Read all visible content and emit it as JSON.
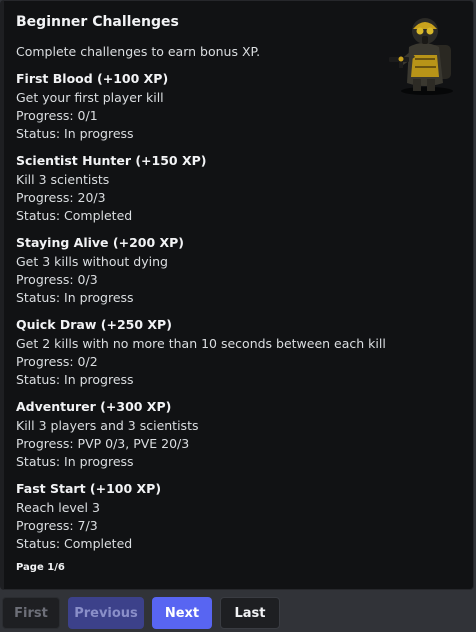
{
  "embed": {
    "title": "Beginner Challenges",
    "description": "Complete challenges to earn bonus XP.",
    "thumbnail_icon": "hazmat-soldier-icon",
    "footer": "Page 1/6",
    "fields": [
      {
        "name": "First Blood (+100 XP)",
        "task": "Get your first player kill",
        "progress": "Progress: 0/1",
        "status": "Status: In progress"
      },
      {
        "name": "Scientist Hunter (+150 XP)",
        "task": "Kill 3 scientists",
        "progress": "Progress: 20/3",
        "status": "Status: Completed"
      },
      {
        "name": "Staying Alive (+200 XP)",
        "task": "Get 3 kills without dying",
        "progress": "Progress: 0/3",
        "status": "Status: In progress"
      },
      {
        "name": "Quick Draw (+250 XP)",
        "task": "Get 2 kills with no more than 10 seconds between each kill",
        "progress": "Progress: 0/2",
        "status": "Status: In progress"
      },
      {
        "name": "Adventurer (+300 XP)",
        "task": "Kill 3 players and 3 scientists",
        "progress": "Progress: PVP 0/3, PVE 20/3",
        "status": "Status: In progress"
      },
      {
        "name": "Fast Start (+100 XP)",
        "task": "Reach level 3",
        "progress": "Progress: 7/3",
        "status": "Status: Completed"
      }
    ]
  },
  "buttons": {
    "first": "First",
    "previous": "Previous",
    "next": "Next",
    "last": "Last"
  },
  "colors": {
    "blurple": "#5865f2",
    "embed_bg": "#111214"
  }
}
